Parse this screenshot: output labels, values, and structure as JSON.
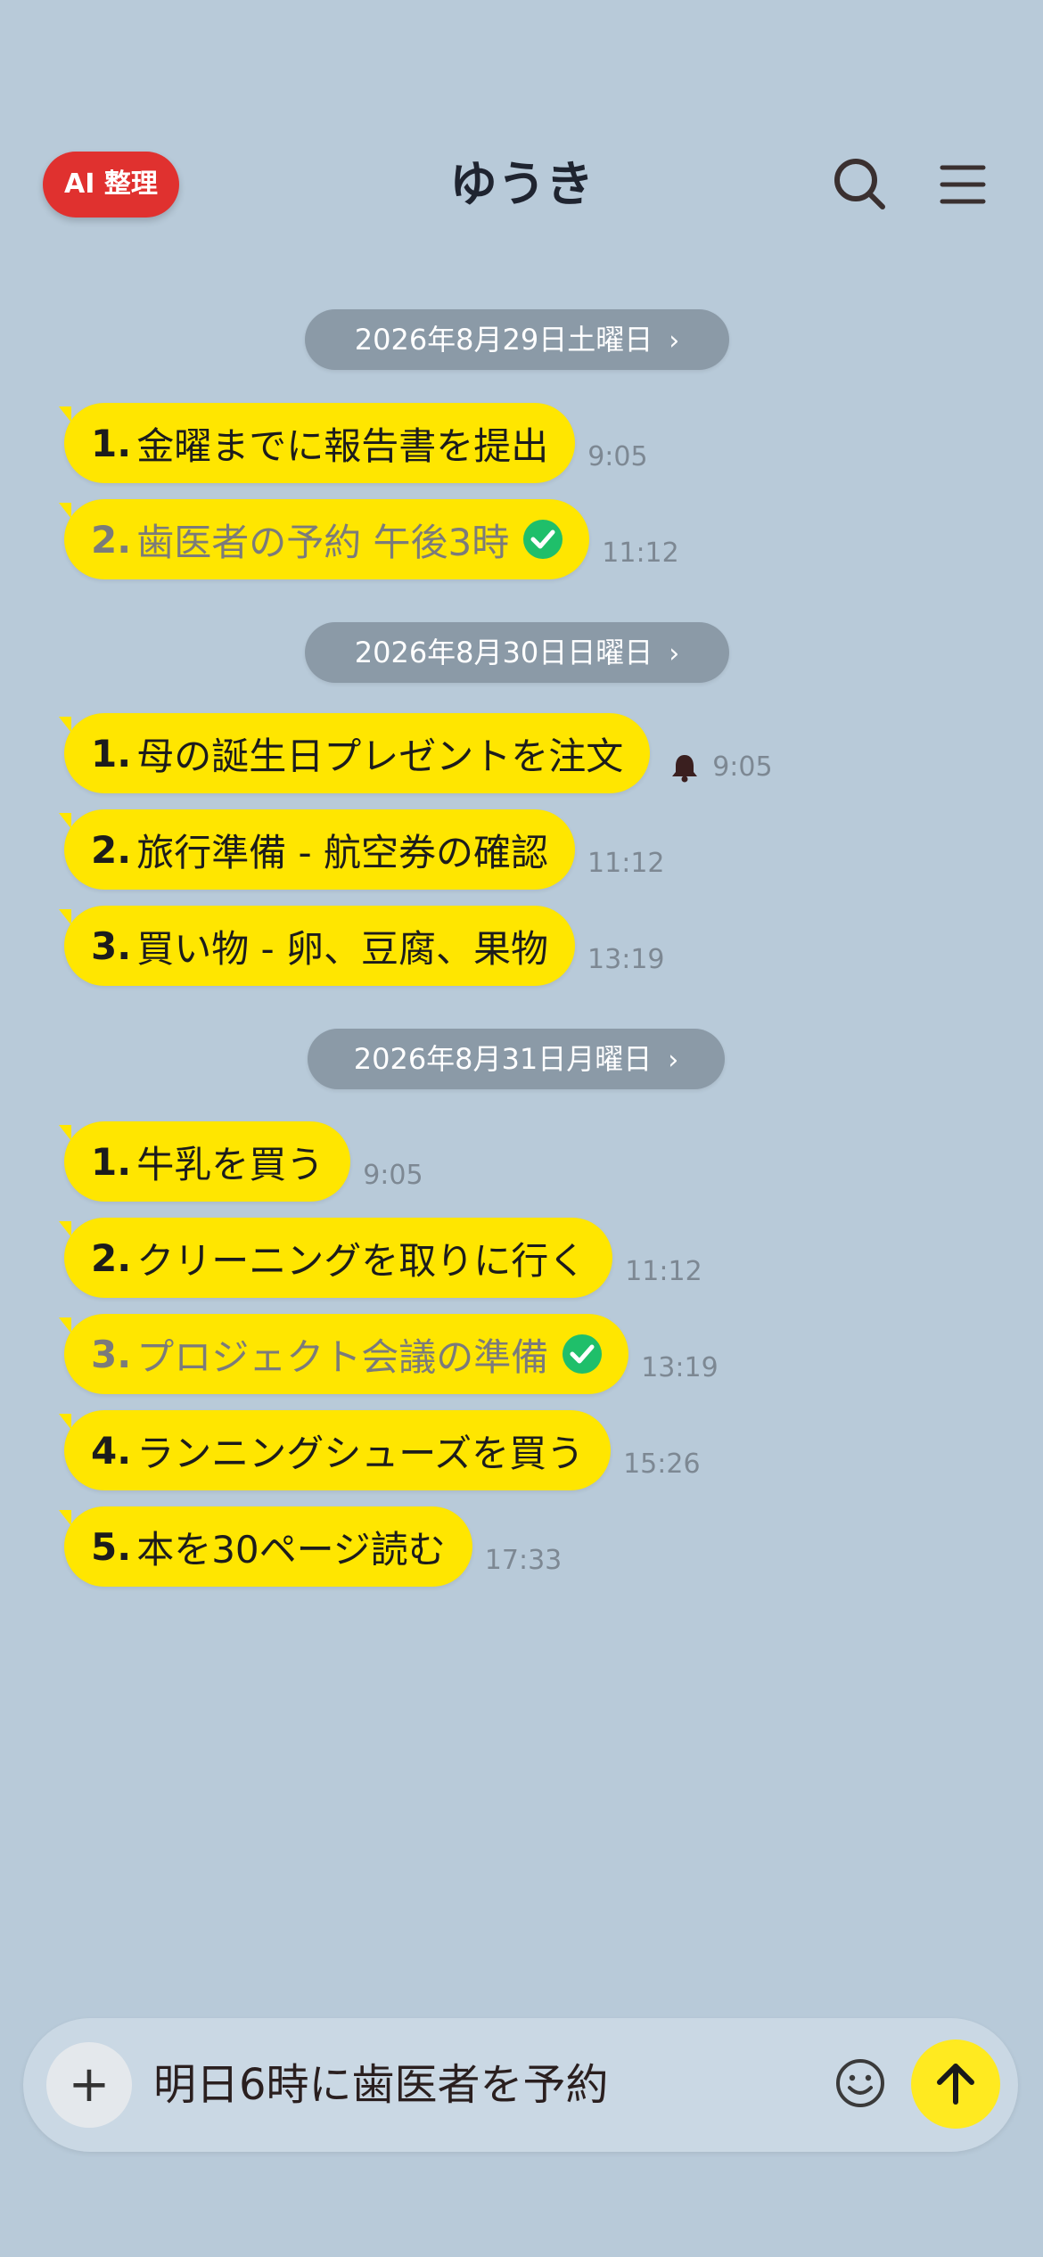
{
  "header": {
    "ai_button_label": "AI 整理",
    "title": "ゆうき",
    "search_icon": "search-icon",
    "menu_icon": "menu-icon"
  },
  "dates": [
    {
      "label": "2026年8月29日土曜日",
      "messages": [
        {
          "num": "1.",
          "text": "金曜までに報告書を提出",
          "time": "9:05",
          "done": false,
          "bell": false
        },
        {
          "num": "2.",
          "text": "歯医者の予約 午後3時",
          "time": "11:12",
          "done": true,
          "bell": false
        }
      ]
    },
    {
      "label": "2026年8月30日日曜日",
      "messages": [
        {
          "num": "1.",
          "text": "母の誕生日プレゼントを注文",
          "time": "9:05",
          "done": false,
          "bell": true
        },
        {
          "num": "2.",
          "text": "旅行準備 - 航空券の確認",
          "time": "11:12",
          "done": false,
          "bell": false
        },
        {
          "num": "3.",
          "text": "買い物 - 卵、豆腐、果物",
          "time": "13:19",
          "done": false,
          "bell": false
        }
      ]
    },
    {
      "label": "2026年8月31日月曜日",
      "messages": [
        {
          "num": "1.",
          "text": "牛乳を買う",
          "time": "9:05",
          "done": false,
          "bell": false
        },
        {
          "num": "2.",
          "text": "クリーニングを取りに行く",
          "time": "11:12",
          "done": false,
          "bell": false
        },
        {
          "num": "3.",
          "text": "プロジェクト会議の準備",
          "time": "13:19",
          "done": true,
          "bell": false
        },
        {
          "num": "4.",
          "text": "ランニングシューズを買う",
          "time": "15:26",
          "done": false,
          "bell": false
        },
        {
          "num": "5.",
          "text": "本を30ページ読む",
          "time": "17:33",
          "done": false,
          "bell": false
        }
      ]
    }
  ],
  "composer": {
    "plus_label": "+",
    "input_value": "明日6時に歯医者を予約",
    "emoji_icon": "smile-icon",
    "send_icon": "arrow-up-icon"
  },
  "colors": {
    "background": "#b8cad9",
    "bubble": "#ffe600",
    "ai_button": "#e0312f",
    "check": "#1fbf6a",
    "date_pill": "#8b9aa7",
    "send": "#ffea20"
  }
}
